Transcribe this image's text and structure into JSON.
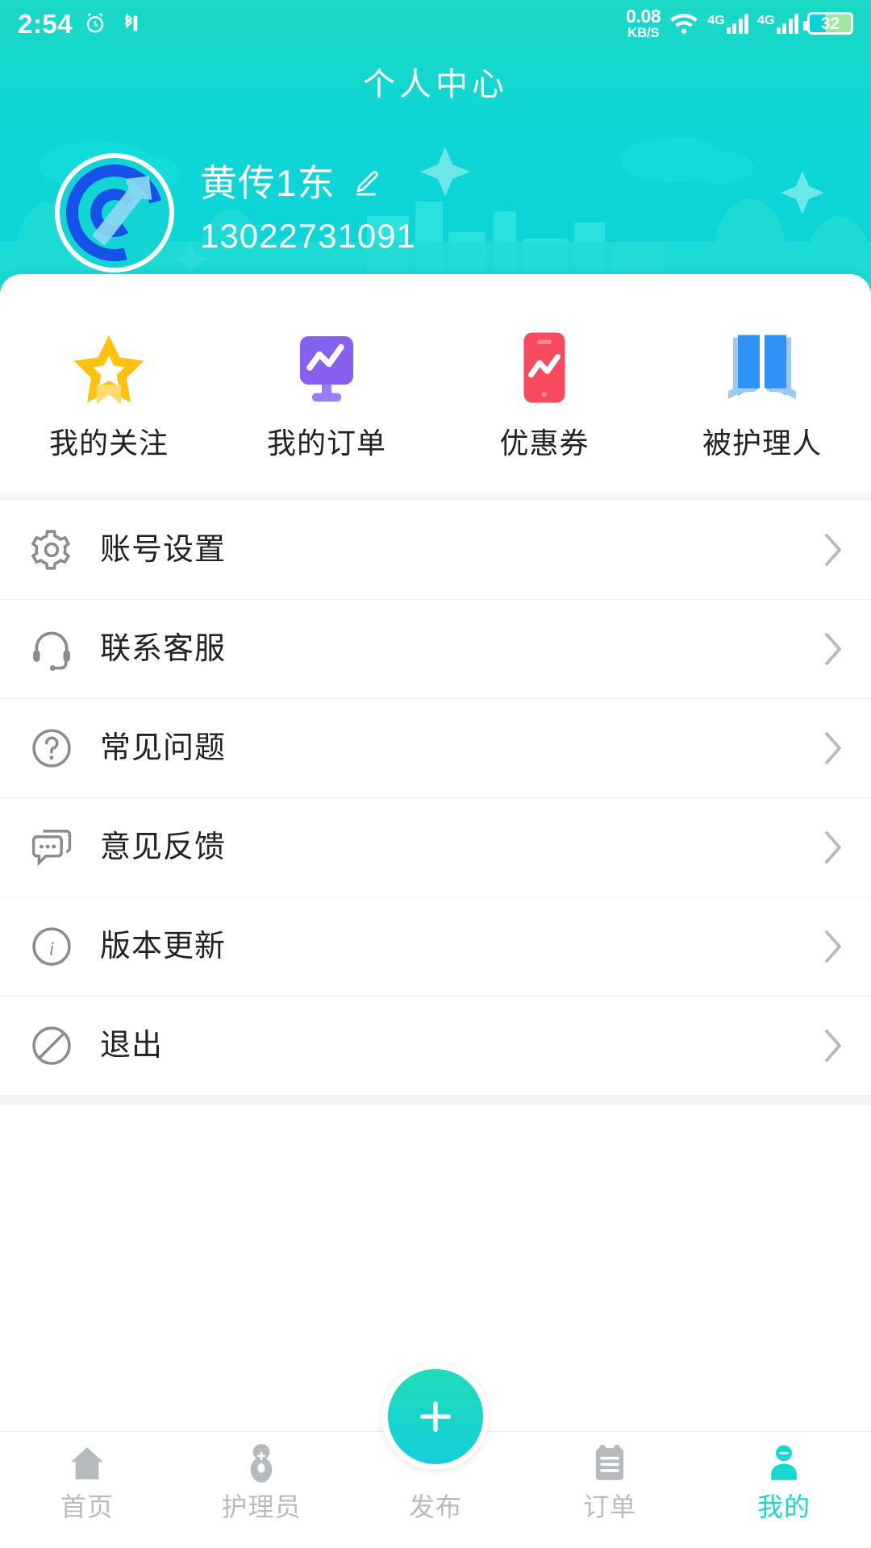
{
  "statusbar": {
    "time": "2:54",
    "alarm_icon": "alarm-clock-icon",
    "bluetooth_icon": "bluetooth-icon",
    "net_speed_value": "0.08",
    "net_speed_unit": "KB/S",
    "wifi_icon": "wifi-icon",
    "signal1_label": "4G",
    "signal2_label": "4G",
    "battery_percent": "32"
  },
  "header": {
    "title": "个人中心",
    "avatar_icon": "target-dart-avatar",
    "user_name": "黄传1东",
    "edit_icon": "pencil-edit-icon",
    "phone": "13022731091",
    "bg_color": "#0fd6d6"
  },
  "quick_actions": [
    {
      "label": "我的关注",
      "icon": "star-icon",
      "color": "#FFC20E"
    },
    {
      "label": "我的订单",
      "icon": "monitor-chart-icon",
      "color": "#8661F0"
    },
    {
      "label": "优惠券",
      "icon": "phone-chart-icon",
      "color": "#F9495C"
    },
    {
      "label": "被护理人",
      "icon": "open-book-icon",
      "color": "#2E93F7"
    }
  ],
  "menu": [
    {
      "label": "账号设置",
      "icon": "gear-icon",
      "chevron": "chevron-right-icon"
    },
    {
      "label": "联系客服",
      "icon": "headset-icon",
      "chevron": "chevron-right-icon"
    },
    {
      "label": "常见问题",
      "icon": "question-circle-icon",
      "chevron": "chevron-right-icon"
    },
    {
      "label": "意见反馈",
      "icon": "chat-bubble-icon",
      "chevron": "chevron-right-icon"
    },
    {
      "label": "版本更新",
      "icon": "info-circle-icon",
      "chevron": "chevron-right-icon"
    },
    {
      "label": "退出",
      "icon": "block-circle-icon",
      "chevron": "chevron-right-icon"
    }
  ],
  "tabbar": {
    "active_color": "#17d8cf",
    "inactive_color": "#b8bcc0",
    "items": [
      {
        "label": "首页",
        "icon": "home-icon",
        "active": false
      },
      {
        "label": "护理员",
        "icon": "nurse-icon",
        "active": false
      },
      {
        "label": "发布",
        "icon": "plus-icon",
        "active": false
      },
      {
        "label": "订单",
        "icon": "clipboard-icon",
        "active": false
      },
      {
        "label": "我的",
        "icon": "person-icon",
        "active": true
      }
    ],
    "fab_icon": "plus-icon"
  }
}
